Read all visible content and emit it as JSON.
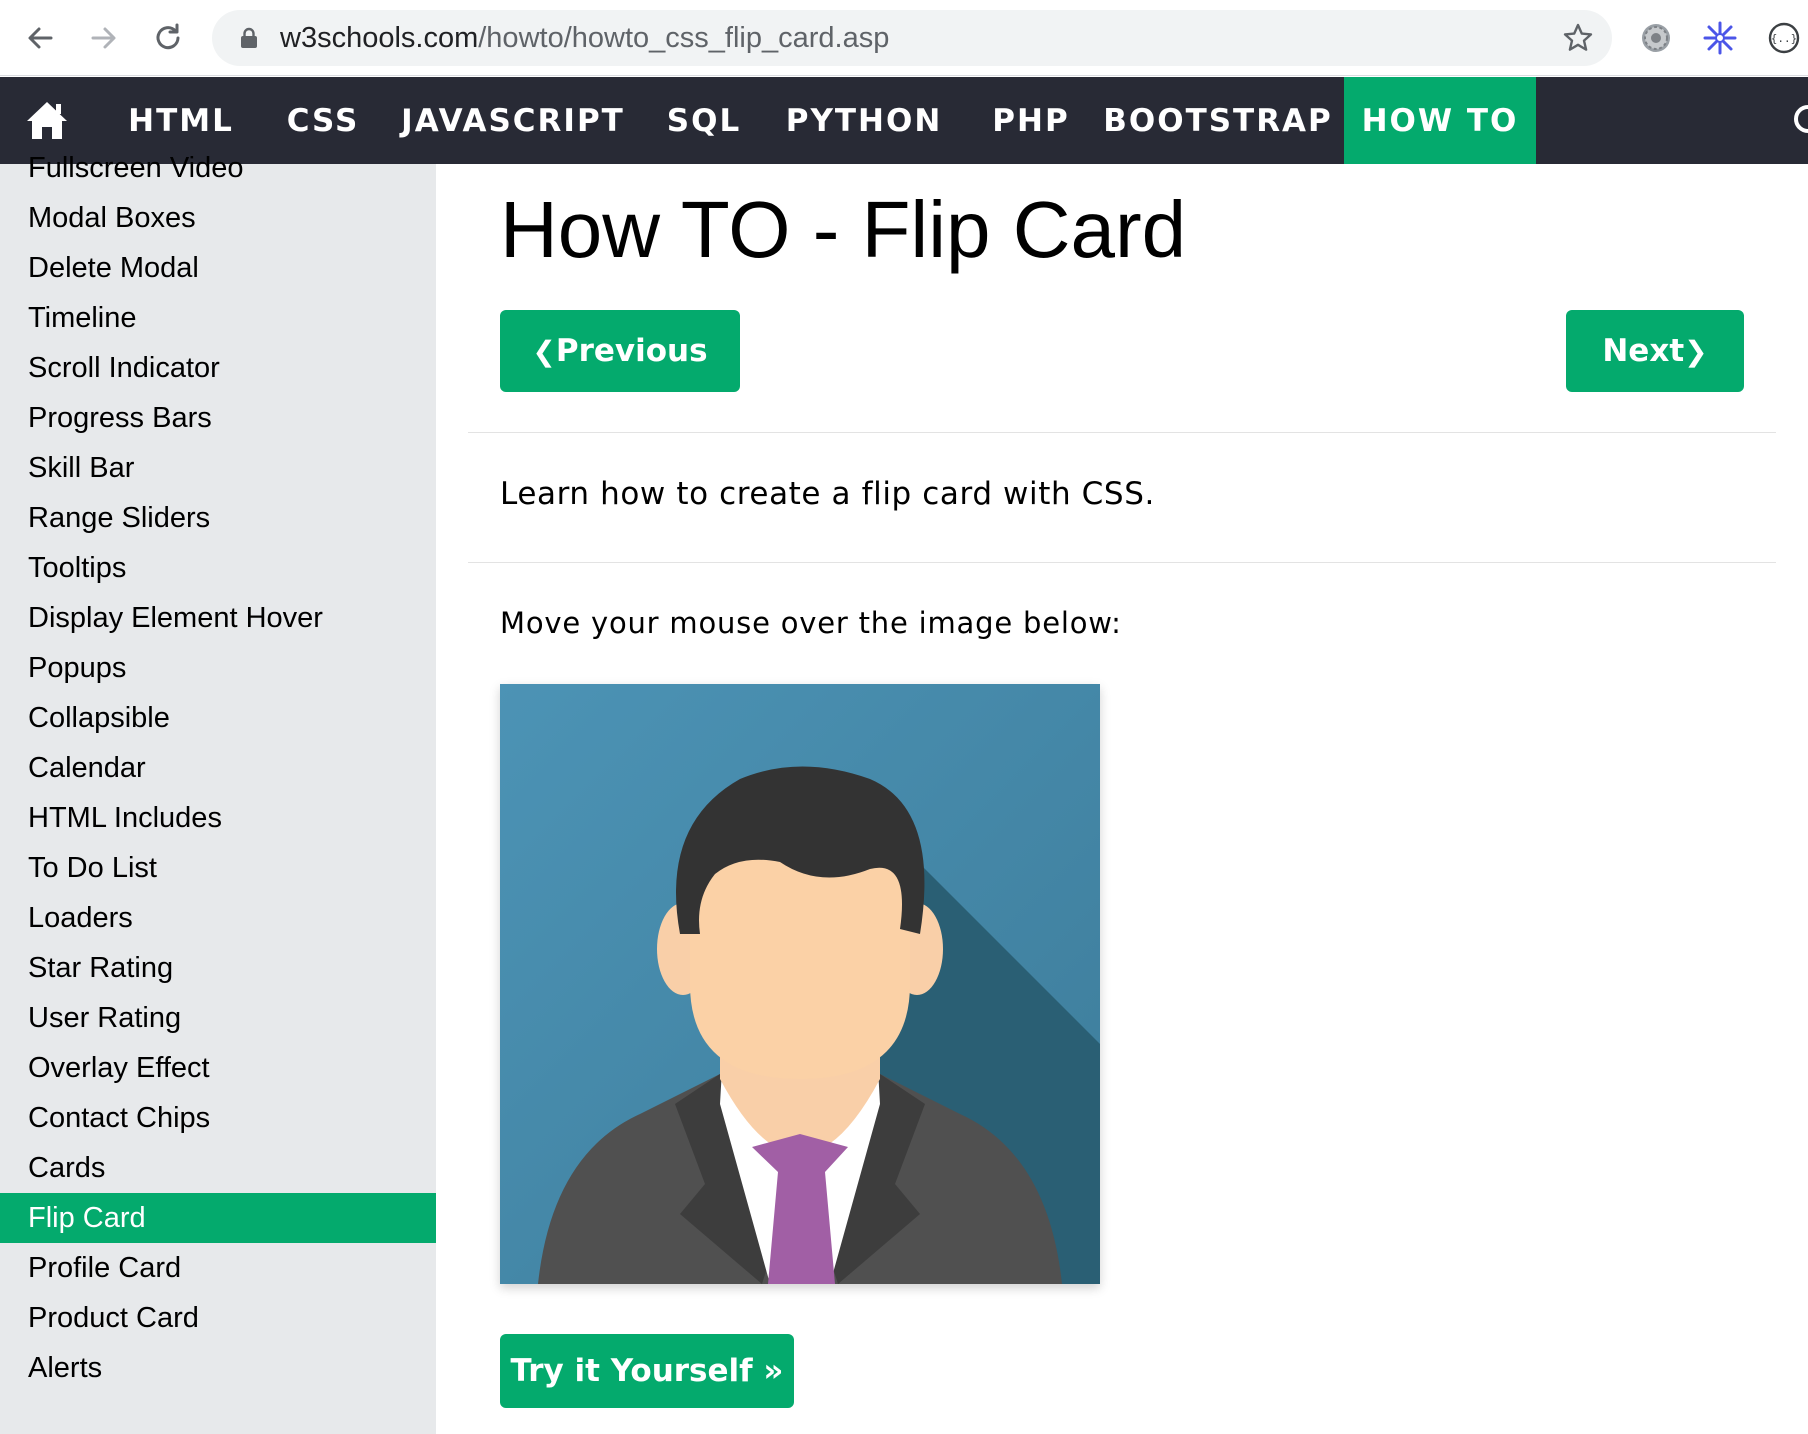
{
  "browser": {
    "url_host": "w3schools.com",
    "url_path": "/howto/howto_css_flip_card.asp",
    "icons": [
      "back-arrow-icon",
      "forward-arrow-icon",
      "reload-icon",
      "lock-icon",
      "star-icon",
      "gear-extension-icon",
      "snowflake-extension-icon",
      "json-extension-icon"
    ]
  },
  "topnav": {
    "home_icon": "home-icon",
    "items": [
      "HTML",
      "CSS",
      "JAVASCRIPT",
      "SQL",
      "PYTHON",
      "PHP",
      "BOOTSTRAP",
      "HOW TO"
    ],
    "active": "HOW TO",
    "accent_color": "#04aa6d",
    "bar_color": "#282a35"
  },
  "sidebar": {
    "items": [
      "Fullscreen Video",
      "Modal Boxes",
      "Delete Modal",
      "Timeline",
      "Scroll Indicator",
      "Progress Bars",
      "Skill Bar",
      "Range Sliders",
      "Tooltips",
      "Display Element Hover",
      "Popups",
      "Collapsible",
      "Calendar",
      "HTML Includes",
      "To Do List",
      "Loaders",
      "Star Rating",
      "User Rating",
      "Overlay Effect",
      "Contact Chips",
      "Cards",
      "Flip Card",
      "Profile Card",
      "Product Card",
      "Alerts"
    ],
    "active": "Flip Card",
    "background": "#e7e9eb"
  },
  "main": {
    "title": "How TO - Flip Card",
    "previous_label": "Previous",
    "next_label": "Next",
    "prev_chevron": "❮",
    "next_chevron": "❯",
    "intro": "Learn how to create a flip card with CSS.",
    "hover_hint": "Move your mouse over the image below:",
    "try_label": "Try it Yourself »",
    "card_image": "avatar-person-illustration"
  }
}
